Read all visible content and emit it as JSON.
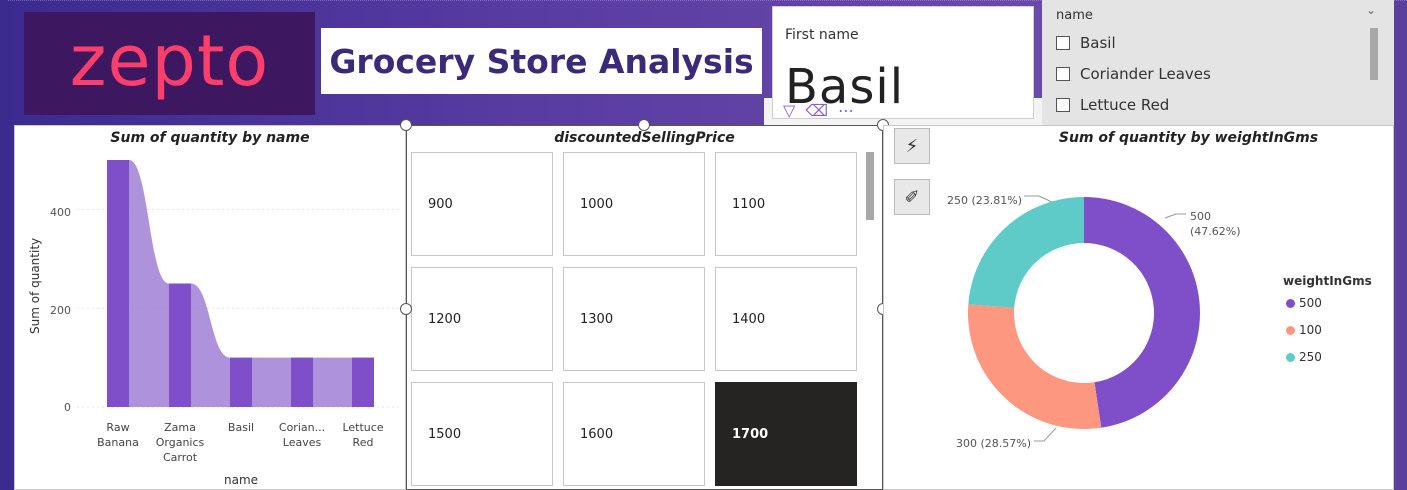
{
  "header": {
    "logo_text": "zepto",
    "title": "Grocery Store Analysis"
  },
  "card": {
    "label": "First name",
    "value": "Basil",
    "icons": [
      "filter-icon",
      "eraser-icon",
      "more-icon"
    ]
  },
  "slicer": {
    "header": "name",
    "items": [
      {
        "label": "Basil",
        "checked": false
      },
      {
        "label": "Coriander Leaves",
        "checked": false
      },
      {
        "label": "Lettuce Red",
        "checked": false
      }
    ]
  },
  "bar_panel": {
    "title": "Sum of quantity by name",
    "ylabel": "Sum of quantity",
    "xlabel": "name",
    "yticks": [
      "0",
      "200",
      "400"
    ],
    "categories": [
      [
        "Raw",
        "Banana"
      ],
      [
        "Zama",
        "Organics",
        "Carrot"
      ],
      [
        "Basil"
      ],
      [
        "Corian...",
        "Leaves"
      ],
      [
        "Lettuce",
        "Red"
      ]
    ]
  },
  "tile_panel": {
    "title": "discountedSellingPrice",
    "tiles": [
      "900",
      "1000",
      "1100",
      "1200",
      "1300",
      "1400",
      "1500",
      "1600",
      "1700"
    ],
    "selected": "1700"
  },
  "side_buttons": [
    "quick-insights-icon",
    "format-painter-icon"
  ],
  "donut_panel": {
    "title": "Sum of quantity by weightInGms",
    "legend_title": "weightInGms",
    "legend": [
      "500",
      "100",
      "250"
    ],
    "labels": {
      "l500a": "500",
      "l500b": "(47.62%)",
      "l300": "300 (28.57%)",
      "l250": "250 (23.81%)"
    }
  },
  "colors": {
    "purple": "#7f4fc9",
    "purple_light": "#a07fd6",
    "orange": "#fd977f",
    "teal": "#5ecbc8",
    "banner": "#5a3da3",
    "logo_bg": "#3d1760",
    "logo_text": "#ff3e6c",
    "title_text": "#3b2a7a"
  },
  "chart_data": [
    {
      "type": "bar",
      "title": "Sum of quantity by name",
      "xlabel": "name",
      "ylabel": "Sum of quantity",
      "categories": [
        "Raw Banana",
        "Zama Organics Carrot",
        "Basil",
        "Coriander Leaves",
        "Lettuce Red"
      ],
      "values": [
        500,
        250,
        100,
        100,
        100
      ],
      "ylim": [
        0,
        500
      ],
      "yticks": [
        0,
        200,
        400
      ],
      "grid": true
    },
    {
      "type": "pie",
      "title": "Sum of quantity by weightInGms",
      "legend_title": "weightInGms",
      "categories": [
        "500",
        "100",
        "250"
      ],
      "values": [
        500,
        300,
        250
      ],
      "percent": [
        47.62,
        28.57,
        23.81
      ],
      "legend_position": "right"
    }
  ]
}
